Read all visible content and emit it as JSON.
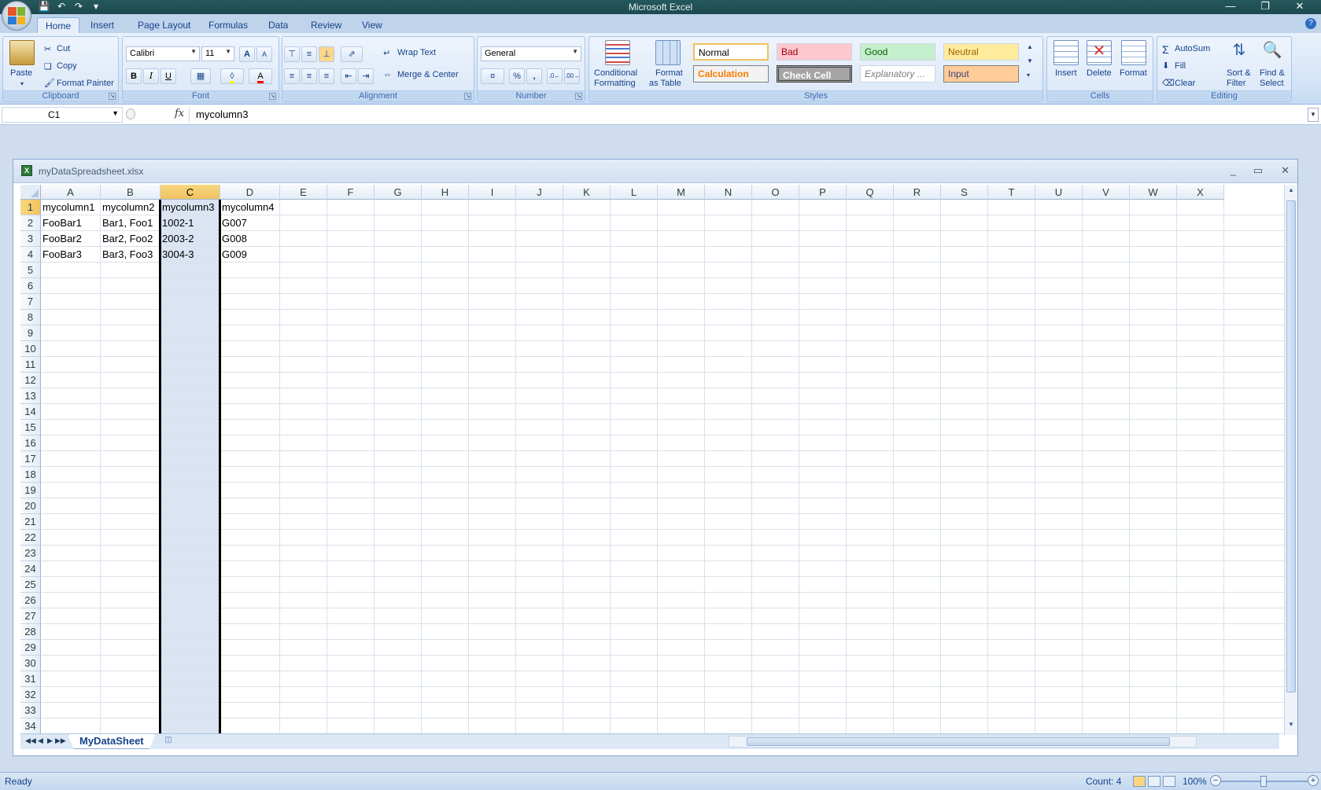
{
  "app": {
    "title": "Microsoft Excel"
  },
  "ribbon_tabs": [
    "Home",
    "Insert",
    "Page Layout",
    "Formulas",
    "Data",
    "Review",
    "View"
  ],
  "active_tab": "Home",
  "clipboard": {
    "paste": "Paste",
    "cut": "Cut",
    "copy": "Copy",
    "format_painter": "Format Painter",
    "label": "Clipboard"
  },
  "font": {
    "name": "Calibri",
    "size": "11",
    "bold": "B",
    "italic": "I",
    "underline": "U",
    "label": "Font",
    "grow": "A",
    "shrink": "A"
  },
  "alignment": {
    "wrap_text": "Wrap Text",
    "merge_center": "Merge & Center",
    "label": "Alignment"
  },
  "number": {
    "format": "General",
    "percent": "%",
    "comma": ",",
    "label": "Number"
  },
  "styles": {
    "conditional_formatting_1": "Conditional",
    "conditional_formatting_2": "Formatting",
    "format_as_table_1": "Format",
    "format_as_table_2": "as Table",
    "normal": "Normal",
    "bad": "Bad",
    "good": "Good",
    "neutral": "Neutral",
    "calculation": "Calculation",
    "check_cell": "Check Cell",
    "explanatory": "Explanatory ...",
    "input": "Input",
    "label": "Styles"
  },
  "cells_group": {
    "insert": "Insert",
    "delete": "Delete",
    "format": "Format",
    "label": "Cells"
  },
  "editing": {
    "autosum": "AutoSum",
    "fill": "Fill",
    "clear": "Clear",
    "sort_filter_1": "Sort &",
    "sort_filter_2": "Filter",
    "find_select_1": "Find &",
    "find_select_2": "Select",
    "label": "Editing"
  },
  "formula_bar": {
    "name_box": "C1",
    "fx": "fx",
    "value": "mycolumn3"
  },
  "workbook": {
    "filename": "myDataSpreadsheet.xlsx",
    "columns": [
      "A",
      "B",
      "C",
      "D",
      "E",
      "F",
      "G",
      "H",
      "I",
      "J",
      "K",
      "L",
      "M",
      "N",
      "O",
      "P",
      "Q",
      "R",
      "S",
      "T",
      "U",
      "V",
      "W",
      "X"
    ],
    "selected_column": "C",
    "rows": [
      [
        "mycolumn1",
        "mycolumn2",
        "mycolumn3",
        "mycolumn4"
      ],
      [
        "FooBar1",
        "Bar1, Foo1",
        "1002-1",
        "G007"
      ],
      [
        "FooBar2",
        "Bar2, Foo2",
        "2003-2",
        "G008"
      ],
      [
        "FooBar3",
        "Bar3, Foo3",
        "3004-3",
        "G009"
      ]
    ],
    "row_count": 34,
    "sheet_tab": "MyDataSheet"
  },
  "status": {
    "ready": "Ready",
    "count": "Count: 4",
    "zoom": "100%"
  }
}
